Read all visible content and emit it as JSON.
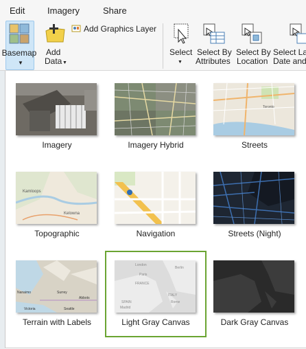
{
  "menu": {
    "edit": "Edit",
    "imagery": "Imagery",
    "share": "Share"
  },
  "ribbon": {
    "basemap": "Basemap",
    "add_data_1": "Add",
    "add_data_2": "Data",
    "add_graphics_layer": "Add Graphics Layer",
    "select": "Select",
    "select_by_attributes_1": "Select By",
    "select_by_attributes_2": "Attributes",
    "select_by_location_1": "Select By",
    "select_by_location_2": "Location",
    "select_layer_1": "Select Lay",
    "select_layer_2": "Date and"
  },
  "basemaps": [
    {
      "label": "Imagery"
    },
    {
      "label": "Imagery Hybrid"
    },
    {
      "label": "Streets"
    },
    {
      "label": "Topographic"
    },
    {
      "label": "Navigation"
    },
    {
      "label": "Streets (Night)"
    },
    {
      "label": "Terrain with Labels"
    },
    {
      "label": "Light Gray Canvas",
      "selected": true
    },
    {
      "label": "Dark Gray Canvas"
    }
  ],
  "map_text": {
    "kamloops": "Kamloops",
    "kelowna": "Kelowna",
    "nanaimo": "Nanaimo",
    "surrey": "Surrey",
    "abbots": "Abbots",
    "victoria": "Victoria",
    "seattle": "Seattle",
    "france": "FRANCE",
    "italy": "ITALY",
    "spain": "SPAIN",
    "madrid": "Madrid",
    "rome": "Rome",
    "paris": "Paris",
    "london": "London",
    "berlin": "Berlin",
    "toronto": "Toronto"
  },
  "colors": {
    "selection": "#6aa431",
    "ribbon_active": "#cfe6f7",
    "ribbon_bg": "#f6f6f6"
  }
}
